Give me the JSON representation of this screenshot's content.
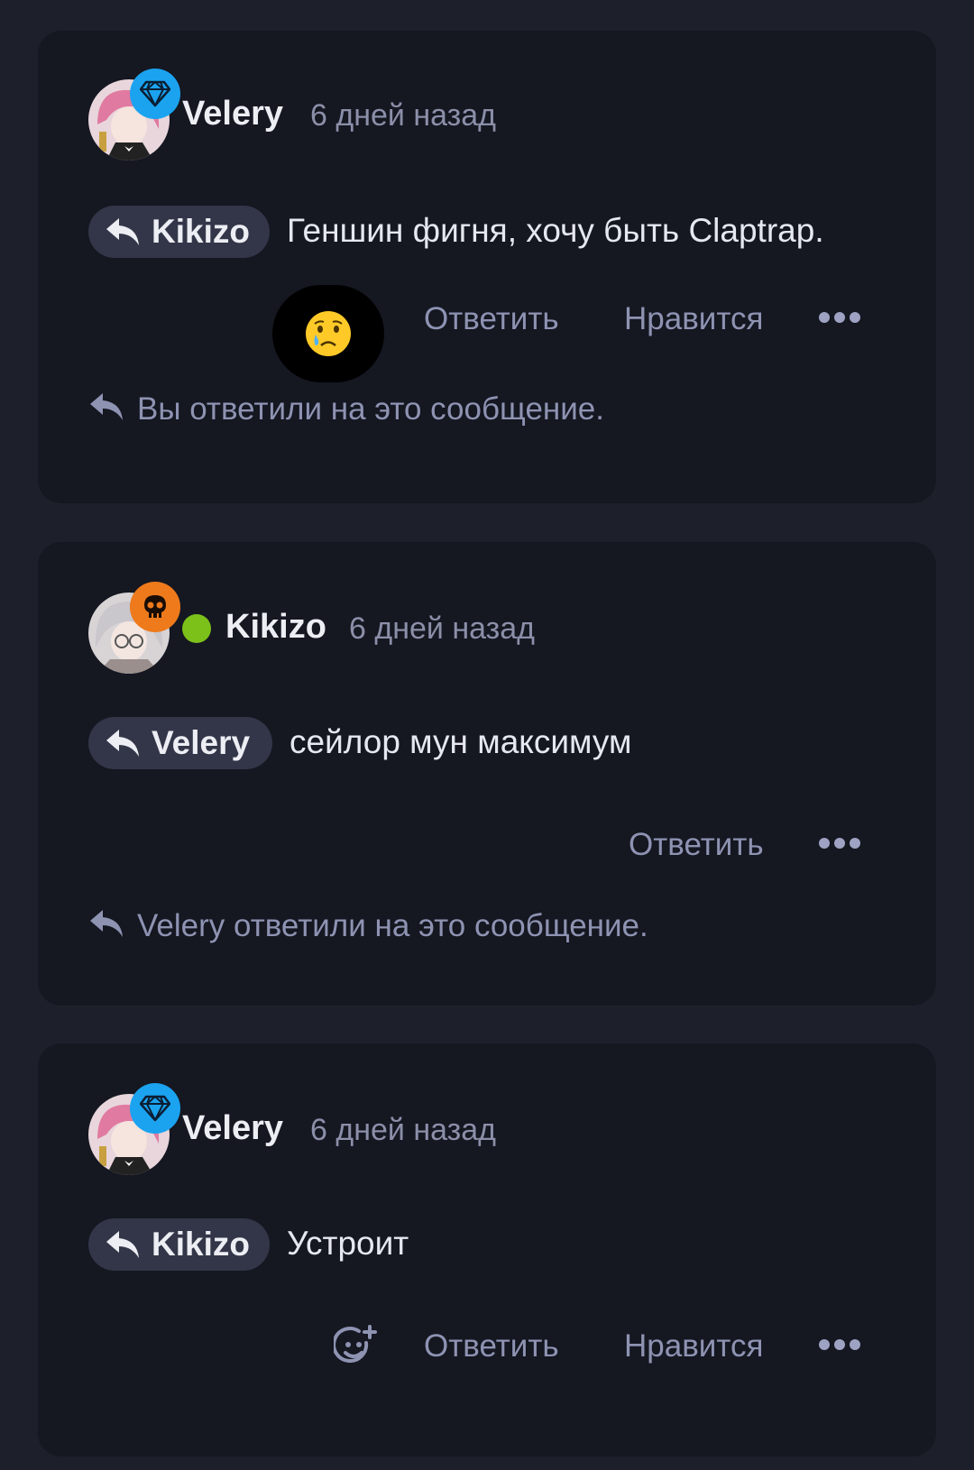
{
  "comments": [
    {
      "author": "Velery",
      "time": "6 дней назад",
      "reply_to": "Kikizo",
      "text": "Геншин фигня, хочу быть Claptrap.",
      "reaction_icon": "crying-face-emoji",
      "actions": {
        "reply": "Ответить",
        "like": "Нравится"
      },
      "status": "Вы ответили на это сообщение."
    },
    {
      "author": "Kikizo",
      "time": "6 дней назад",
      "reply_to": "Velery",
      "text": "сейлор мун максимум",
      "online": true,
      "actions": {
        "reply": "Ответить"
      },
      "status": "Velery ответили на это сообщение."
    },
    {
      "author": "Velery",
      "time": "6 дней назад",
      "reply_to": "Kikizo",
      "text": "Устроит",
      "add_reaction_icon": "add-reaction-icon",
      "actions": {
        "reply": "Ответить",
        "like": "Нравится"
      }
    }
  ],
  "colors": {
    "background": "#1d1f2b",
    "card": "#151721",
    "pill": "#333648",
    "muted_text": "#8e93b2",
    "diamond_badge": "#1ba3f0",
    "skull_badge": "#ee7a1c",
    "online": "#7cc11a"
  }
}
